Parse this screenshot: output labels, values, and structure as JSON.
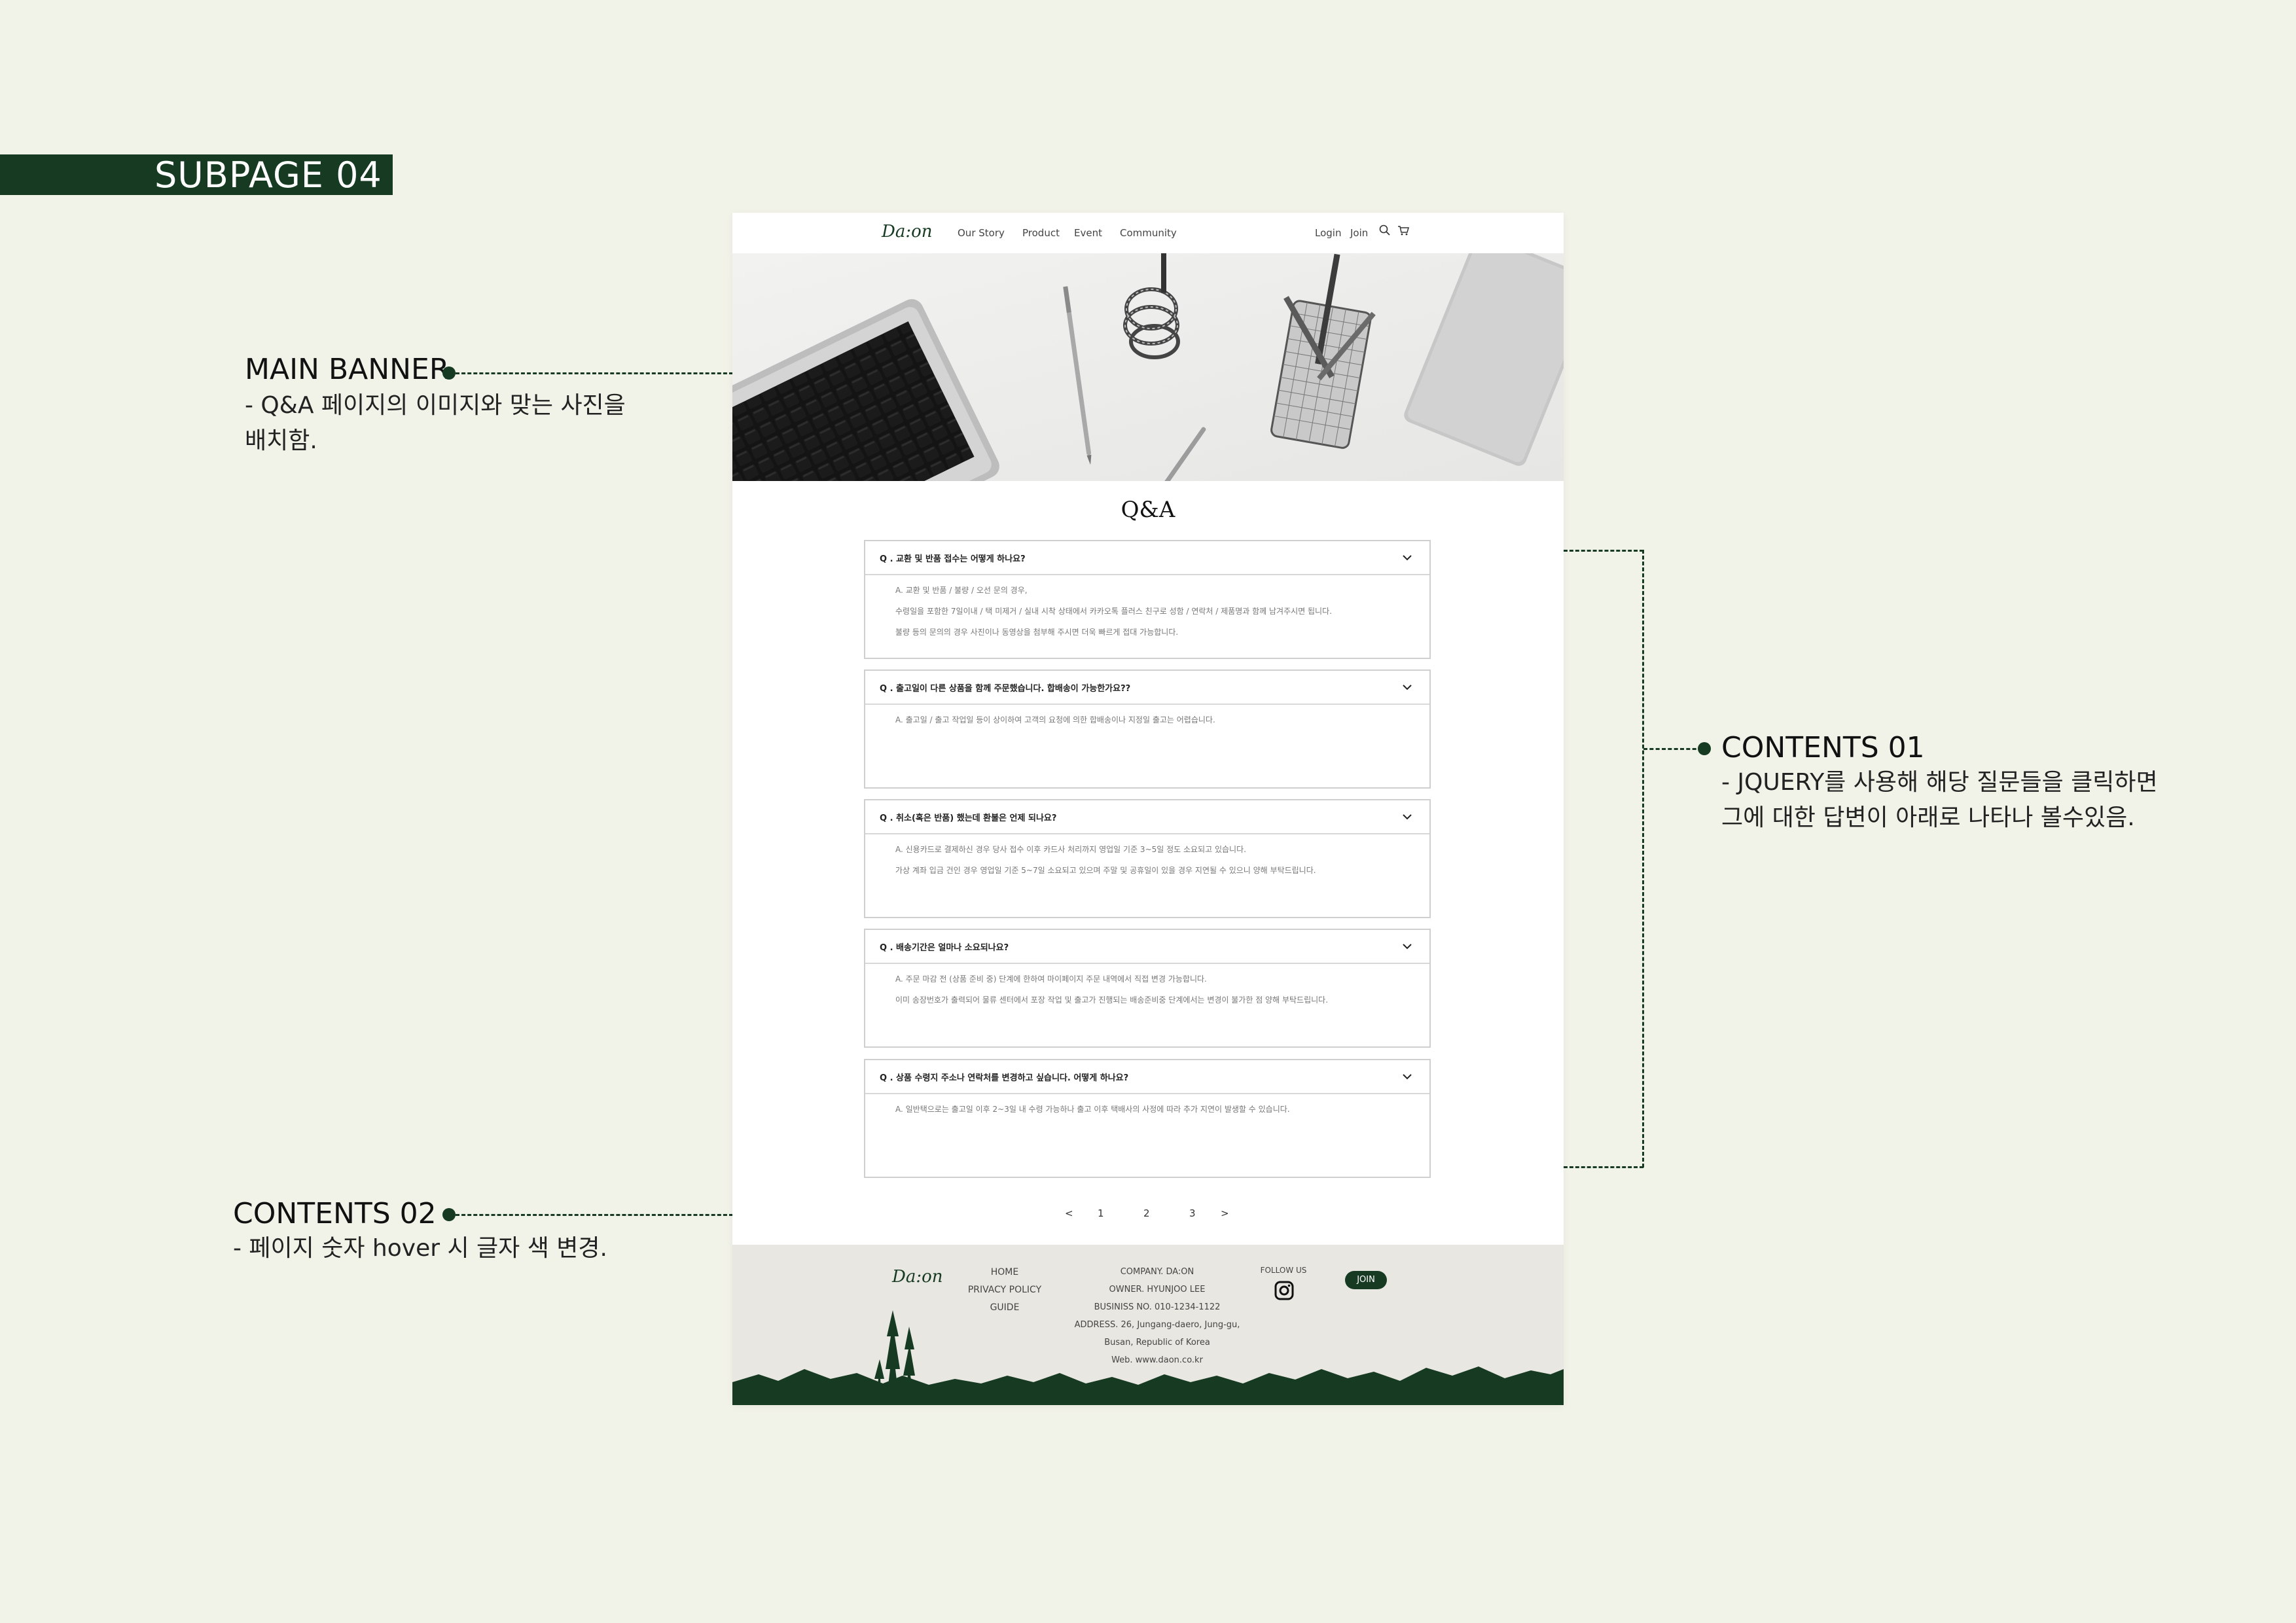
{
  "board": {
    "subpage_tag": "SUBPAGE 04",
    "annotations": {
      "main_banner": {
        "title": "MAIN BANNER",
        "desc": [
          "- Q&A 페이지의 이미지와 맞는 사진을",
          "배치함."
        ]
      },
      "contents_01": {
        "title": "CONTENTS 01",
        "desc": [
          "- JQUERY를 사용해 해당 질문들을 클릭하면",
          "그에 대한 답변이 아래로 나타나  볼수있음."
        ]
      },
      "contents_02": {
        "title": "CONTENTS 02",
        "desc": [
          "- 페이지 숫자 hover 시 글자 색 변경."
        ]
      }
    }
  },
  "site": {
    "logo": "Da:on",
    "nav": [
      "Our Story",
      "Product",
      "Event",
      "Community"
    ],
    "nav_right": {
      "login": "Login",
      "join": "Join"
    },
    "page_title": "Q&A",
    "faqs": [
      {
        "q": "Q . 교환 및 반품 접수는 어떻게 하나요?",
        "a": [
          "A. 교환 및 반품 / 불량 / 오선 문의 경우,",
          "수령일을 포함한 7일이내 / 택 미제거 / 실내 시착 상태에서 카카오톡 플러스 친구로 성함 / 연락처 / 제품명과 함께 남겨주시면 됩니다.",
          "불량 등의 문의의 경우 사진이나 동영상을 첨부해 주시면 더욱 빠르게 접대 가능합니다."
        ]
      },
      {
        "q": "Q . 출고일이 다른 상품을 함께 주문했습니다. 합배송이 가능한가요??",
        "a": [
          "A. 출고일 / 출고 작업일 등이 상이하여 고객의 요청에 의한 합배송이나 지정일 출고는 어렵습니다."
        ]
      },
      {
        "q": "Q . 취소(혹은 반품) 했는데 환불은 언제 되나요?",
        "a": [
          "A. 신용카드로 결제하신 경우 당사 접수 이후 카드사 처리까지 영업일 기준 3~5일 정도 소요되고 있습니다.",
          "가상 계좌 입금 건인 경우 영업일 기준 5~7일 소요되고 있으며 주말 및 공휴일이 있을 경우 지연될 수 있으니 양해 부탁드립니다."
        ]
      },
      {
        "q": "Q . 배송기간은 얼마나 소요되나요?",
        "a": [
          "A. 주문 마감 전 (상품 준비 중) 단계에 한하여 마이페이지 주문 내역에서 직접 변경 가능합니다.",
          "이미 송장번호가 출력되어 물류 센터에서 포장 작업 및 출고가 진행되는 배송준비중 단계에서는 변경이 불가한 점 양해 부탁드립니다."
        ]
      },
      {
        "q": "Q . 상품 수령지 주소나 연락처를 변경하고 싶습니다. 어떻게 하나요?",
        "a": [
          "A. 일반택으로는 출고일 이후 2~3일 내 수령 가능하나 출고 이후 택배사의 사정에 따라 추가 지연이 발생할 수 있습니다."
        ]
      }
    ],
    "pagination": [
      "<",
      "1",
      "2",
      "3",
      ">"
    ],
    "footer": {
      "logo": "Da:on",
      "links": [
        "HOME",
        "PRIVACY POLICY",
        "GUIDE"
      ],
      "info": [
        "COMPANY. DA:ON",
        "OWNER. HYUNJOO LEE",
        "BUSINISS NO. 010-1234-1122",
        "ADDRESS. 26, Jungang-daero, Jung-gu,",
        "Busan, Republic of Korea",
        "Web. www.daon.co.kr"
      ],
      "follow": "FOLLOW US",
      "join_button": "JOIN"
    }
  },
  "colors": {
    "accent": "#163a22",
    "board_bg": "#f1f2e8",
    "footer_bg": "#e8e7e1"
  },
  "icons": [
    "search-icon",
    "cart-icon",
    "chevron-down-icon",
    "instagram-icon"
  ]
}
